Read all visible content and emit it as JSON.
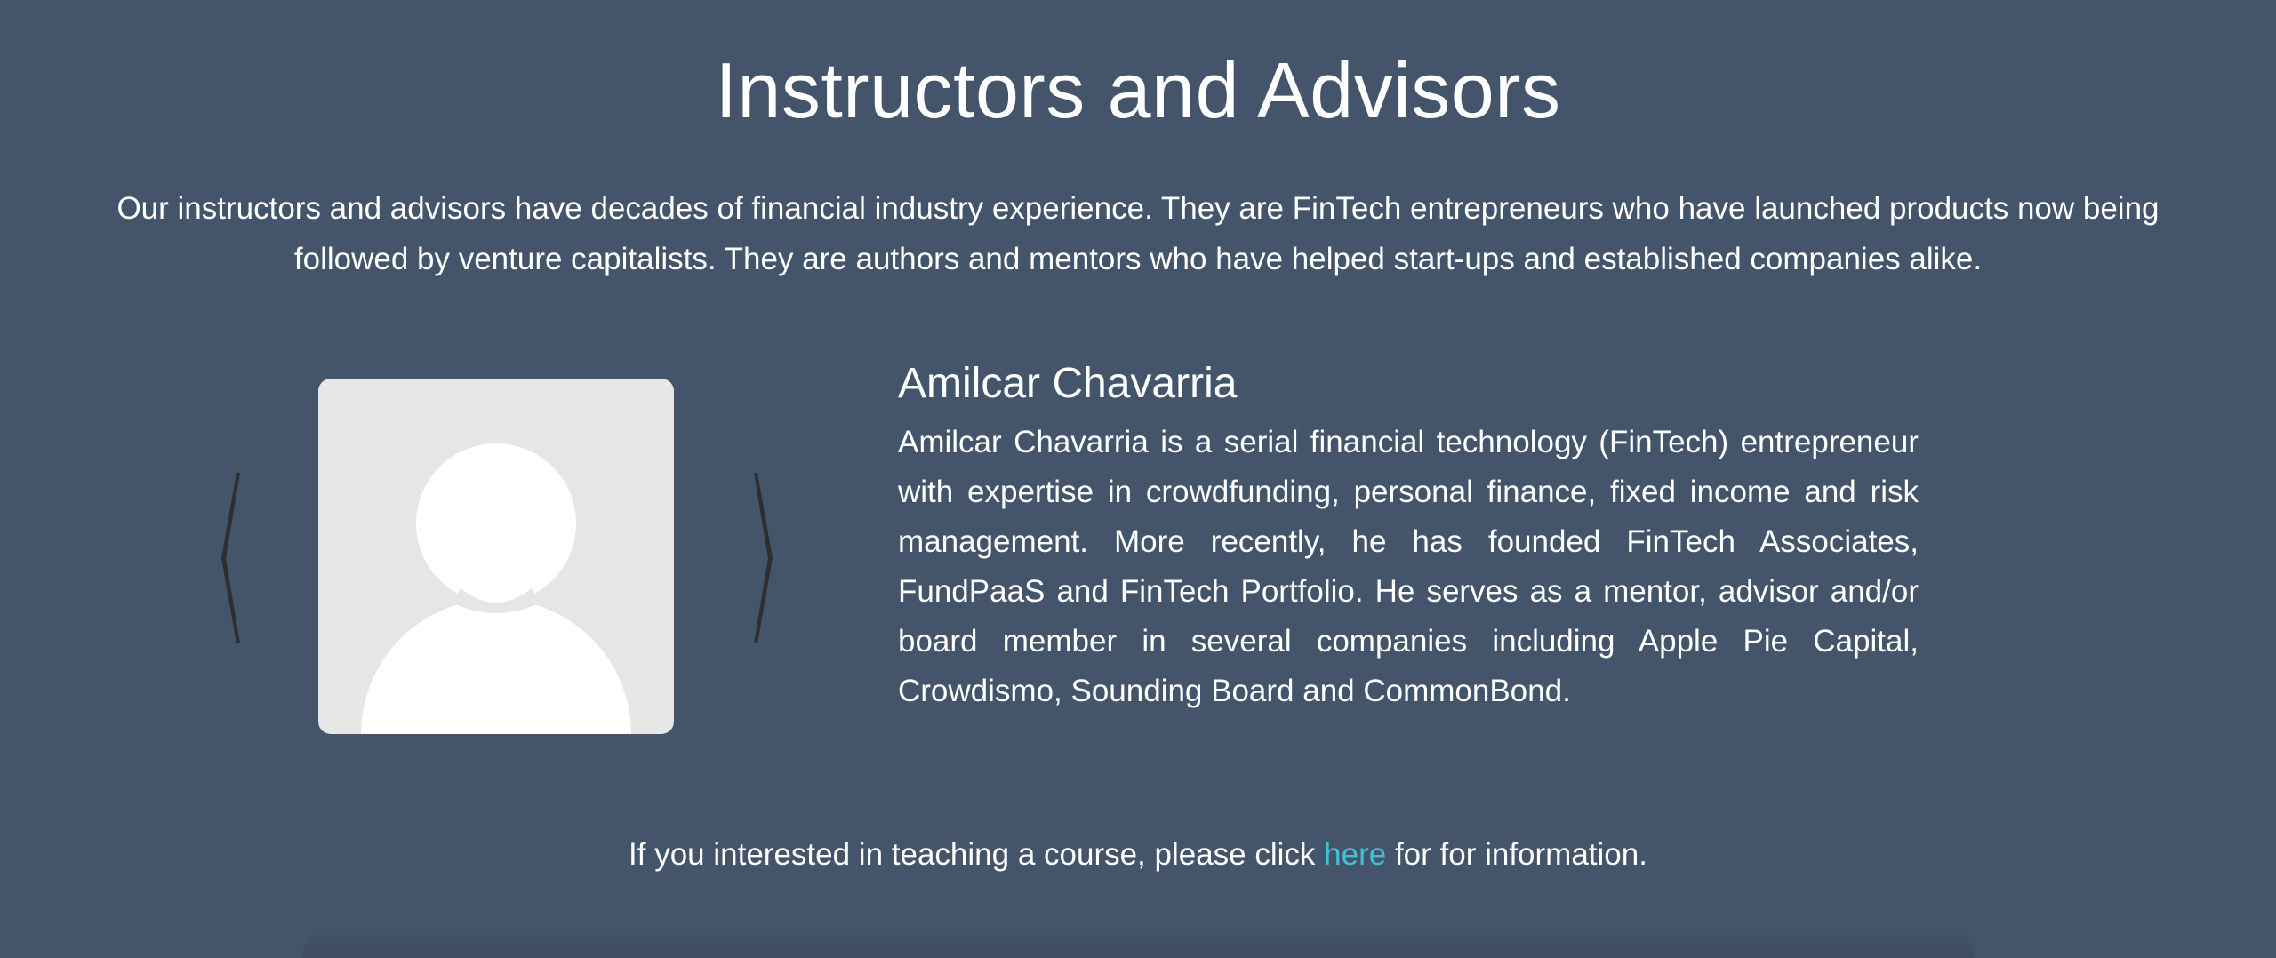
{
  "section": {
    "title": "Instructors and Advisors",
    "intro": "Our instructors and advisors have decades of financial industry experience. They are FinTech entrepreneurs who have launched products now being followed by venture capitalists. They are authors and mentors who have helped start-ups and established companies alike."
  },
  "carousel": {
    "prev_icon": "chevron-left-icon",
    "next_icon": "chevron-right-icon",
    "avatar_icon": "user-placeholder-icon",
    "slide": {
      "name": "Amilcar Chavarria",
      "bio": "Amilcar Chavarria is a serial financial technology (FinTech) entrepreneur with expertise in crowdfunding, personal finance, fixed income and risk management. More recently, he has founded FinTech Associates, FundPaaS and FinTech Portfolio. He serves as a mentor, advisor and/or board member in several companies including Apple Pie Capital, Crowdismo, Sounding Board and CommonBond."
    }
  },
  "cta": {
    "before": "If you interested in teaching a course, please click ",
    "link": "here",
    "after": " for for information."
  },
  "colors": {
    "background": "#44546b",
    "text": "#ffffff",
    "link": "#3fc1d6",
    "avatar_bg": "#e6e6e6",
    "arrow": "#2e2e2e"
  }
}
